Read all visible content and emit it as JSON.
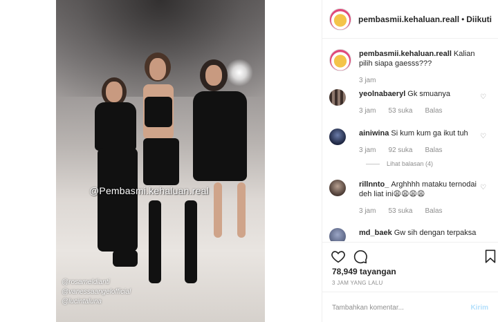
{
  "post": {
    "watermark": "@Pembasmi.kehaluan.real",
    "tags": [
      "@rosameldianti",
      "@vanessaangelofficial",
      "@lucintaluna"
    ]
  },
  "header": {
    "username": "pembasmii.kehaluan.reall",
    "separator": "•",
    "follow_status": "Diikuti"
  },
  "caption": {
    "username": "pembasmii.kehaluan.reall",
    "text": "Kalian pilih siapa gaesss???",
    "time": "3 jam"
  },
  "comments": [
    {
      "username": "yeolnabaeryl",
      "text": "Gk smuanya",
      "time": "3 jam",
      "likes": "53 suka",
      "reply": "Balas"
    },
    {
      "username": "ainiwina",
      "text": "Si kum kum ga ikut tuh",
      "time": "3 jam",
      "likes": "92 suka",
      "reply": "Balas",
      "view_replies": "Lihat balasan (4)"
    },
    {
      "username": "rillnnto_",
      "text": "Arghhhh mataku ternodai deh liat ini😩😩😩😩",
      "time": "3 jam",
      "likes": "53 suka",
      "reply": "Balas"
    },
    {
      "username": "md_baek",
      "text": "Gw sih dengan terpaksa"
    }
  ],
  "stats": {
    "views": "78,949 tayangan",
    "time_ago": "3 JAM YANG LALU"
  },
  "comment_box": {
    "placeholder": "Tambahkan komentar...",
    "send_label": "Kirim"
  },
  "icons": {
    "like": "heart-icon",
    "comment": "comment-icon",
    "save": "bookmark-icon"
  }
}
